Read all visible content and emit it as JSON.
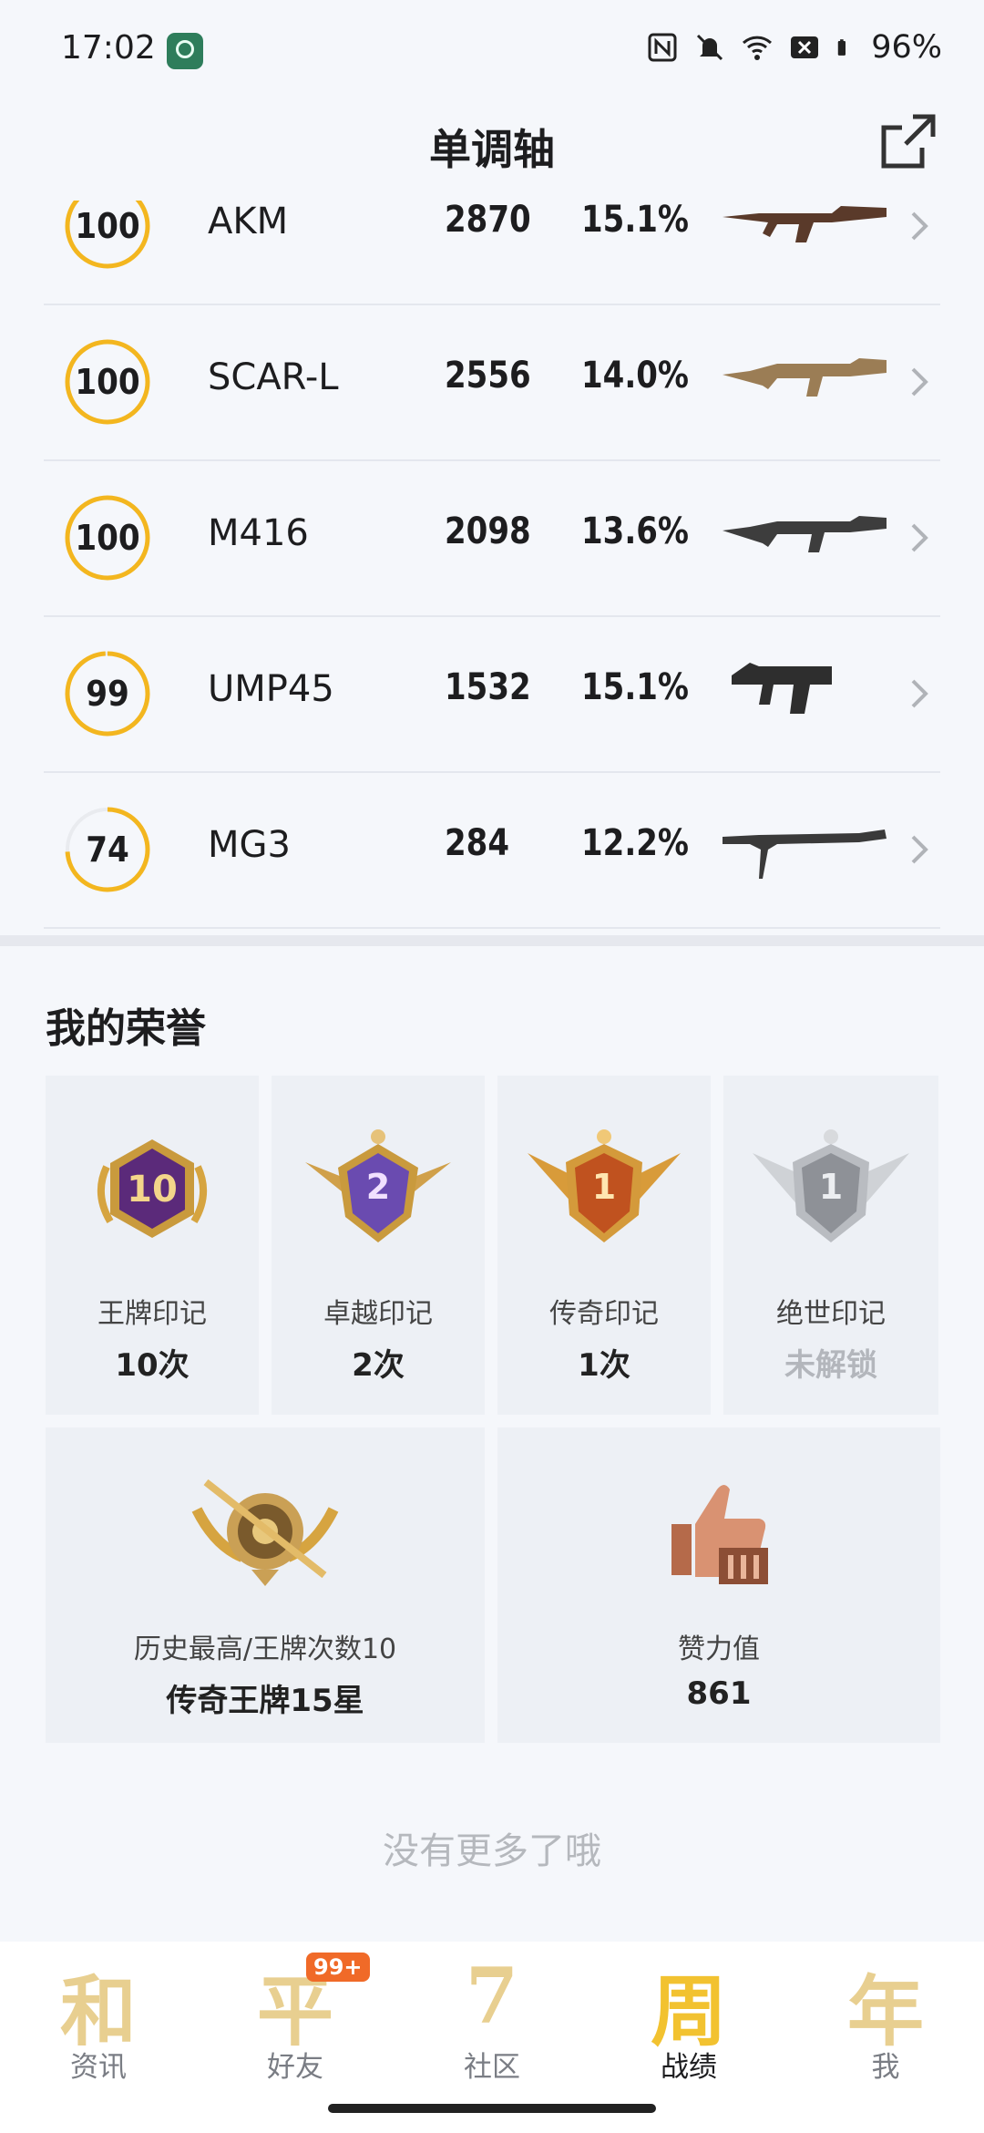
{
  "status_bar": {
    "time": "17:02",
    "battery": "96%",
    "icons": [
      "nfc-icon",
      "mute-icon",
      "wifi-icon",
      "close-box-icon",
      "battery-icon"
    ]
  },
  "header": {
    "title": "单调轴",
    "share_icon": "external-link-icon"
  },
  "weapons": [
    {
      "score": "100",
      "ring_fraction": 1.0,
      "name": "AKM",
      "count": "2870",
      "pct": "15.1%",
      "gun_icon": "akm-rifle-icon"
    },
    {
      "score": "100",
      "ring_fraction": 1.0,
      "name": "SCAR-L",
      "count": "2556",
      "pct": "14.0%",
      "gun_icon": "scar-rifle-icon"
    },
    {
      "score": "100",
      "ring_fraction": 1.0,
      "name": "M416",
      "count": "2098",
      "pct": "13.6%",
      "gun_icon": "m416-rifle-icon"
    },
    {
      "score": "99",
      "ring_fraction": 0.99,
      "name": "UMP45",
      "count": "1532",
      "pct": "15.1%",
      "gun_icon": "ump-smg-icon"
    },
    {
      "score": "74",
      "ring_fraction": 0.74,
      "name": "MG3",
      "count": "284",
      "pct": "12.2%",
      "gun_icon": "mg3-machinegun-icon"
    }
  ],
  "honor": {
    "title": "我的荣誉",
    "marks": [
      {
        "label": "王牌印记",
        "value": "10次",
        "medal_number": "10",
        "medal_icon": "ace-mark-medal-icon",
        "locked": false
      },
      {
        "label": "卓越印记",
        "value": "2次",
        "medal_number": "2",
        "medal_icon": "excellence-mark-medal-icon",
        "locked": false
      },
      {
        "label": "传奇印记",
        "value": "1次",
        "medal_number": "1",
        "medal_icon": "legend-mark-medal-icon",
        "locked": false
      },
      {
        "label": "绝世印记",
        "value": "未解锁",
        "medal_number": "1",
        "medal_icon": "peerless-mark-medal-icon",
        "locked": true
      }
    ],
    "history": {
      "label": "历史最高/王牌次数10",
      "value": "传奇王牌15星",
      "icon": "rank-emblem-icon"
    },
    "likes": {
      "label": "赞力值",
      "value": "861",
      "icon": "thumbs-up-trophy-icon"
    }
  },
  "no_more": "没有更多了哦",
  "tabs": [
    {
      "glyph": "和",
      "label": "资讯",
      "active": false
    },
    {
      "glyph": "平",
      "label": "好友",
      "active": false,
      "badge": "99+"
    },
    {
      "glyph": "7",
      "label": "社区",
      "active": false
    },
    {
      "glyph": "周",
      "label": "战绩",
      "active": true
    },
    {
      "glyph": "年",
      "label": "我",
      "active": false
    }
  ],
  "colors": {
    "ring": "#f3b61f",
    "ring_track": "#e9ebef",
    "background": "#f5f7fb",
    "card": "#edf0f5",
    "badge": "#f06a28"
  }
}
